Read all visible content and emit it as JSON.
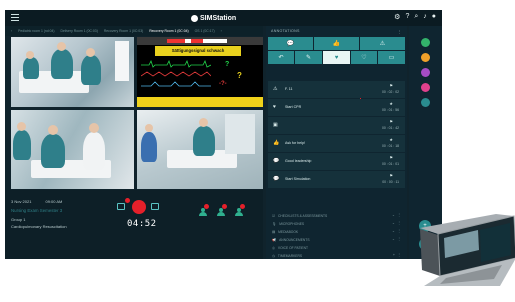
{
  "app": {
    "name": "SIMStation"
  },
  "top_icons": [
    "gear-icon",
    "help-icon",
    "search-icon",
    "bell-icon",
    "user-icon"
  ],
  "breadcrumbs": [
    "Pediatric room 1 (nd:04)",
    "Delivery Room 1 (0C:03)",
    "Recovery Room 1 (0C:03)",
    "Recovery Room 1 (0C:04)",
    "OS 1 (0C:17)"
  ],
  "breadcrumbs_active": 3,
  "vitals": {
    "alarm": "Sättigungssignal schwach"
  },
  "info": {
    "date": "3 Nov 2021",
    "time": "09:00 AM",
    "event": "Nursing Exam Semester 3",
    "group": "Group 1",
    "topic": "Cardiopulmonary Resuscitation"
  },
  "timer": "04:52",
  "annotations": {
    "title": "ANNOTATIONS",
    "quick_buttons": [
      "chat-icon",
      "thumbs-up-icon",
      "warning-icon",
      "undo-icon",
      "edit-icon",
      "heart-icon",
      "heart-icon",
      "screen-icon"
    ],
    "items": [
      {
        "icon": "warning-icon",
        "text": "F. 11",
        "mark": "flag",
        "time": "00 : 02 : 02"
      },
      {
        "icon": "heart-icon",
        "text": "Start CPR",
        "mark": "star",
        "time": "00 : 01 : 56"
      },
      {
        "icon": "screen-icon",
        "text": "",
        "mark": "flag",
        "time": "00 : 01 : 42"
      },
      {
        "icon": "thumbs-up-icon",
        "text": "Ask for help!",
        "mark": "star",
        "time": "00 : 01 : 18"
      },
      {
        "icon": "chat-icon",
        "text": "Good leadership",
        "mark": "flag",
        "time": "00 : 01 : 01"
      },
      {
        "icon": "chat-icon",
        "text": "Start Simulation",
        "mark": "flag",
        "time": "00 : 00 : 11"
      }
    ]
  },
  "sections": [
    "CHECKLISTS & ASSESSMENTS",
    "MICROPHONES",
    "MEDIABOOK",
    "ANNOUNCEMENTS",
    "VOICE OF PATIENT",
    "TIMEMARKERS"
  ],
  "rail_colors": [
    "#33b36b",
    "#f0a12a",
    "#a64cc4",
    "#e0418d",
    "#2a8c8f"
  ],
  "colors": {
    "accent": "#2a8c8f",
    "record": "#e5202a",
    "alarm": "#e9d11e"
  }
}
